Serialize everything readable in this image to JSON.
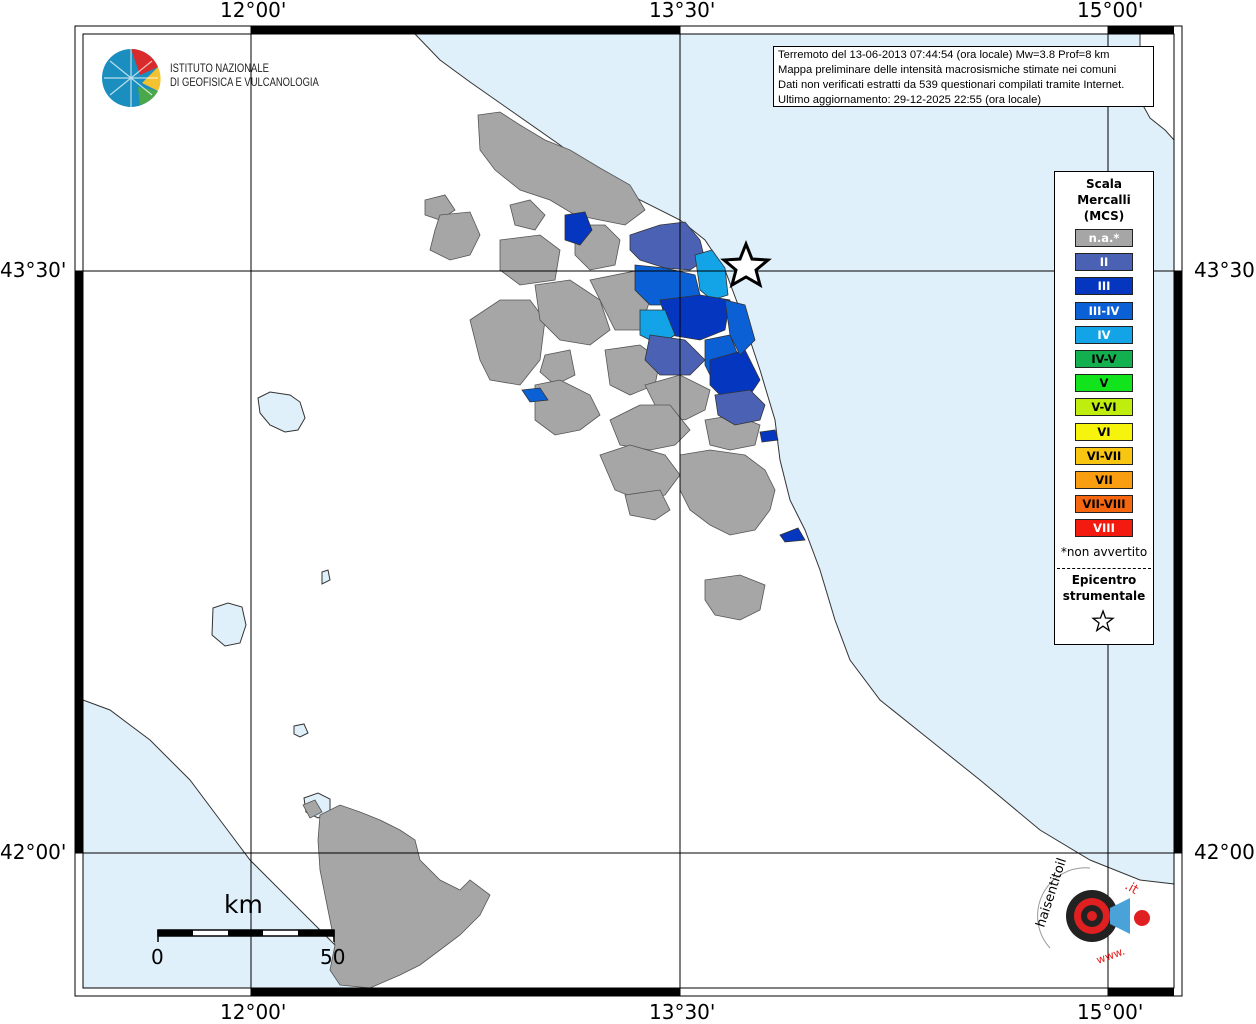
{
  "map": {
    "coords": {
      "lon_top": [
        "12°00'",
        "13°30'",
        "15°00'"
      ],
      "lon_bottom": [
        "12°00'",
        "13°30'",
        "15°00'"
      ],
      "lat_left": [
        "43°30'",
        "42°00'"
      ],
      "lat_right": [
        "43°30'",
        "42°00'"
      ]
    },
    "sea_color": "#dff0fb",
    "land_color": "#ffffff",
    "na_color": "#a6a6a6"
  },
  "info": {
    "line1": "Terremoto del 13-06-2013 07:44:54 (ora locale) Mw=3.8 Prof=8 km",
    "line2": "Mappa preliminare delle intensità macrosismiche stimate nei comuni",
    "line3": "Dati non verificati estratti da 539 questionari compilati tramite Internet.",
    "line4": "Ultimo aggiornamento: 29-12-2025 22:55 (ora locale)"
  },
  "ingv": {
    "line1": "ISTITUTO NAZIONALE",
    "line2": "DI GEOFISICA E VULCANOLOGIA"
  },
  "legend": {
    "title1": "Scala",
    "title2": "Mercalli",
    "title3": "(MCS)",
    "items": [
      {
        "label": "n.a.*",
        "color": "#a6a6a6",
        "text": "#ffffff"
      },
      {
        "label": "II",
        "color": "#4b61b4",
        "text": "#ffffff"
      },
      {
        "label": "III",
        "color": "#0536c0",
        "text": "#ffffff"
      },
      {
        "label": "III-IV",
        "color": "#0a60d4",
        "text": "#ffffff"
      },
      {
        "label": "IV",
        "color": "#12a4e6",
        "text": "#ffffff"
      },
      {
        "label": "IV-V",
        "color": "#12b04e",
        "text": "#000000"
      },
      {
        "label": "V",
        "color": "#11e41c",
        "text": "#000000"
      },
      {
        "label": "V-VI",
        "color": "#bfee0e",
        "text": "#000000"
      },
      {
        "label": "VI",
        "color": "#f6f40c",
        "text": "#000000"
      },
      {
        "label": "VI-VII",
        "color": "#f8c610",
        "text": "#000000"
      },
      {
        "label": "VII",
        "color": "#f99e10",
        "text": "#000000"
      },
      {
        "label": "VII-VIII",
        "color": "#f5660f",
        "text": "#000000"
      },
      {
        "label": "VIII",
        "color": "#f31a10",
        "text": "#ffffff"
      }
    ],
    "na_note": "*non avvertito",
    "epicentre1": "Epicentro",
    "epicentre2": "strumentale"
  },
  "scale": {
    "unit": "km",
    "start": "0",
    "end": "50"
  },
  "hst_logo": {
    "text_black": "haisentitoilterremoto",
    "text_red": ".it",
    "url_text": "www."
  }
}
